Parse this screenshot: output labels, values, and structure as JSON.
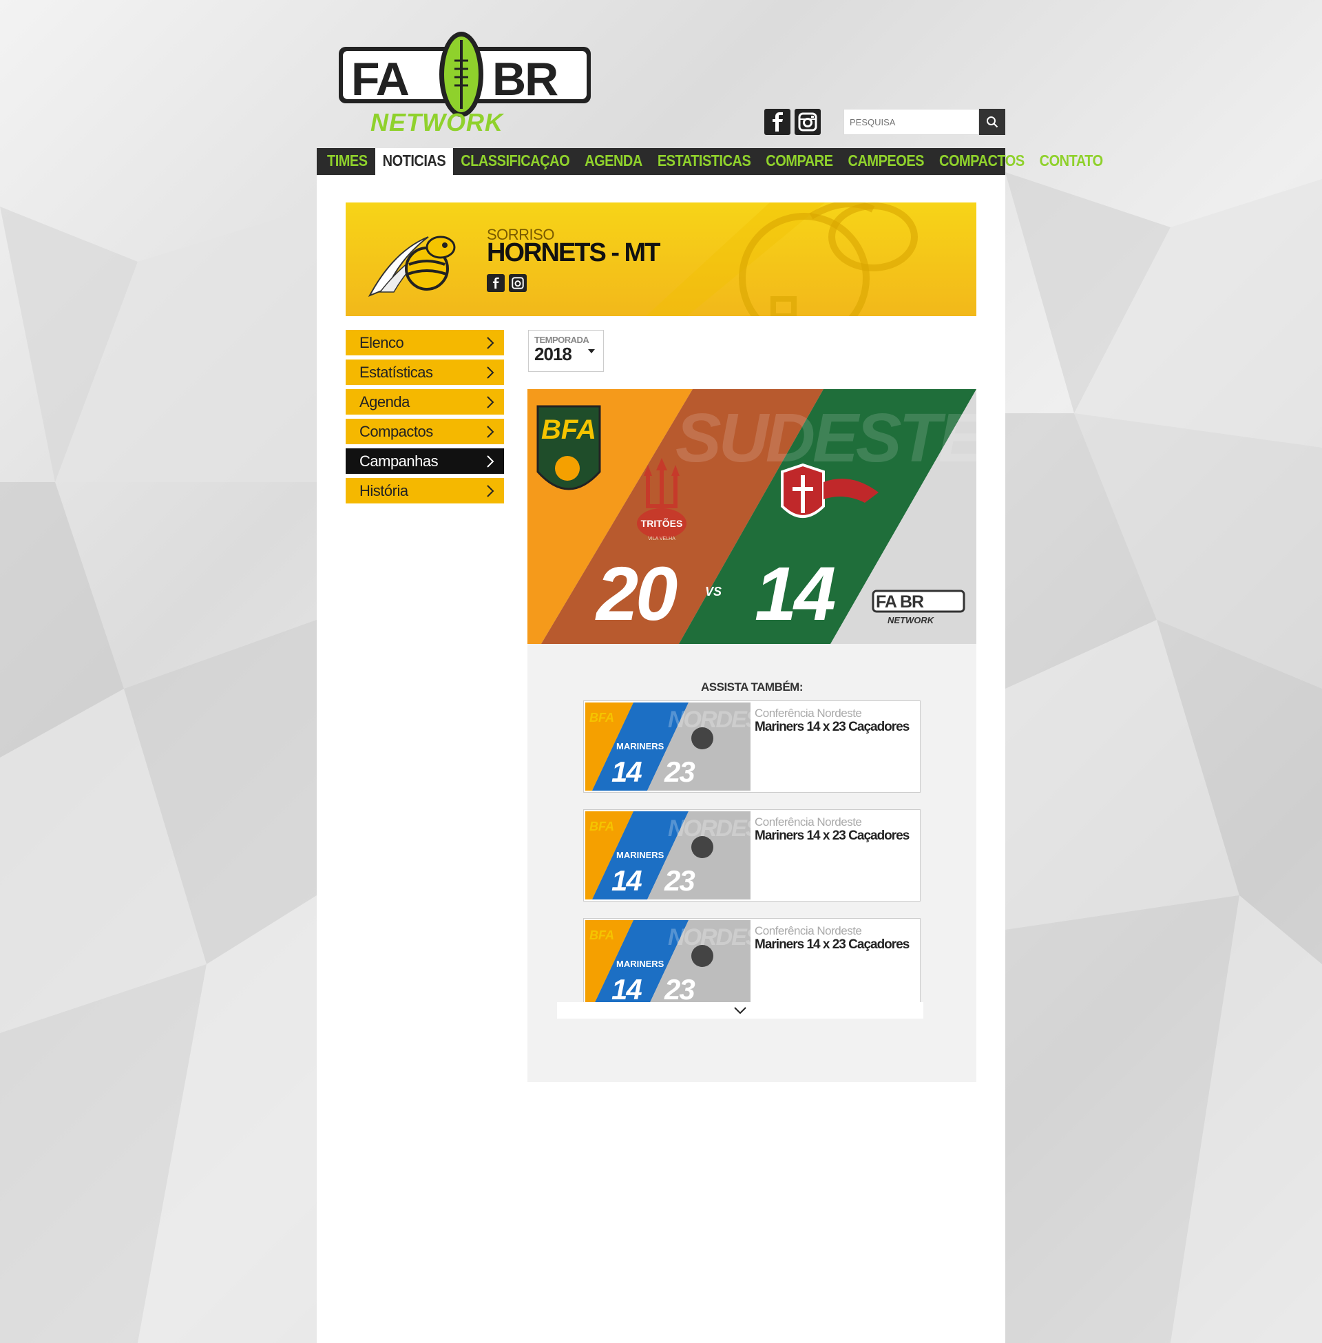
{
  "brand": {
    "logo_text": "FA BR",
    "logo_sub": "NETWORK",
    "accent": "#8fd12c",
    "dark": "#2b2b2b",
    "yellow": "#f5b800"
  },
  "header": {
    "social": [
      {
        "icon": "facebook-icon"
      },
      {
        "icon": "instagram-icon"
      }
    ],
    "search": {
      "placeholder": "PESQUISA"
    }
  },
  "nav": {
    "items": [
      {
        "label": "TIMES"
      },
      {
        "label": "NOTICIAS",
        "active": true
      },
      {
        "label": "CLASSIFICAÇAO"
      },
      {
        "label": "AGENDA"
      },
      {
        "label": "ESTATISTICAS"
      },
      {
        "label": "COMPARE"
      },
      {
        "label": "CAMPEOES"
      },
      {
        "label": "COMPACTOS"
      },
      {
        "label": "CONTATO"
      }
    ]
  },
  "team": {
    "city": "SORRISO",
    "name": "HORNETS - MT"
  },
  "sidemenu": {
    "items": [
      {
        "label": "Elenco"
      },
      {
        "label": "Estatísticas"
      },
      {
        "label": "Agenda"
      },
      {
        "label": "Compactos"
      },
      {
        "label": "Campanhas",
        "active": true
      },
      {
        "label": "História"
      }
    ]
  },
  "season": {
    "label": "TEMPORADA",
    "value": "2018"
  },
  "video": {
    "league": "BFA",
    "conference": "SUDESTE",
    "home_team": "TRITÕES",
    "home_sub": "VILA VELHA",
    "home_score": "20",
    "vs": "VS",
    "away_score": "14",
    "watermark": "FA BR",
    "watermark_sub": "NETWORK"
  },
  "related": {
    "title": "ASSISTA TAMBÉM:",
    "cards": [
      {
        "conference": "Conferência Nordeste",
        "match": "Mariners 14 x 23 Caçadores",
        "thumb_league": "BFA",
        "thumb_conf": "NORDESTE",
        "thumb_team": "MARINERS",
        "score_a": "14",
        "score_b": "23"
      },
      {
        "conference": "Conferência Nordeste",
        "match": "Mariners 14 x 23 Caçadores",
        "thumb_league": "BFA",
        "thumb_conf": "NORDESTE",
        "thumb_team": "MARINERS",
        "score_a": "14",
        "score_b": "23"
      },
      {
        "conference": "Conferência Nordeste",
        "match": "Mariners 14 x 23 Caçadores",
        "thumb_league": "BFA",
        "thumb_conf": "NORDESTE",
        "thumb_team": "MARINERS",
        "score_a": "14",
        "score_b": "23"
      }
    ]
  }
}
